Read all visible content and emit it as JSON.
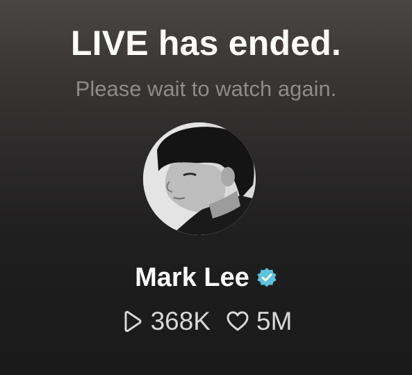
{
  "live_status": {
    "title": "LIVE has ended.",
    "subtitle": "Please wait to watch again."
  },
  "profile": {
    "name": "Mark Lee",
    "verified": true,
    "avatar_icon": "profile-photo",
    "verified_icon": "verified-badge-icon"
  },
  "stats": {
    "views": {
      "icon": "play-icon",
      "value": "368K"
    },
    "likes": {
      "icon": "heart-icon",
      "value": "5M"
    }
  },
  "colors": {
    "background_top": "#4a4644",
    "background_bottom": "#1a1a1a",
    "title": "#ffffff",
    "subtitle": "#8e8b89",
    "verified_badge": "#5bc3dc",
    "stats_text": "#d9d9d9"
  }
}
